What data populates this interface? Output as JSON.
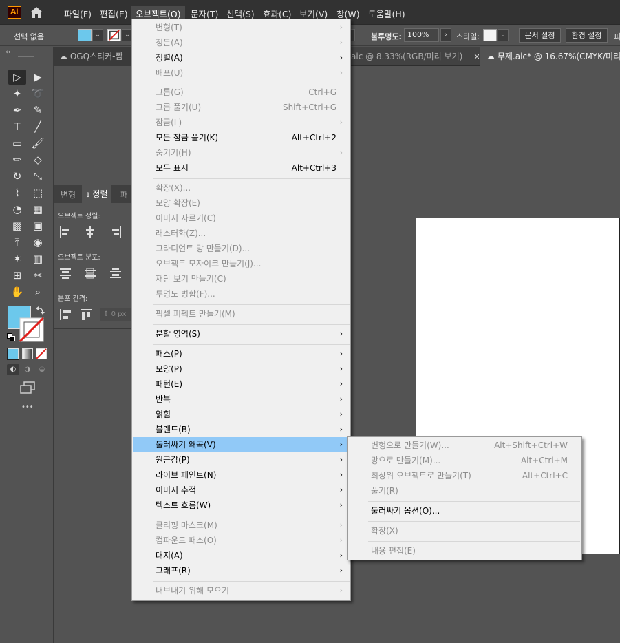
{
  "app": {
    "logo": "Ai",
    "brand_color": "#ff9a00"
  },
  "menubar": {
    "items": [
      "파일(F)",
      "편집(E)",
      "오브젝트(O)",
      "문자(T)",
      "선택(S)",
      "효과(C)",
      "보기(V)",
      "창(W)",
      "도움말(H)"
    ]
  },
  "controlbar": {
    "selection_label": "선택 없음",
    "fill_color": "#6cc8ec",
    "opacity_label": "불투명도:",
    "opacity_value": "100%",
    "style_label": "스타일:",
    "doc_setup_button": "문서 설정",
    "prefs_button": "환경 설정",
    "overflow_char": "피"
  },
  "tabs": [
    {
      "label": "OGQ스티커-짬"
    },
    {
      "label": "aic @ 8.33%(RGB/미리 보기)"
    },
    {
      "label": "무제.aic* @ 16.67%(CMYK/미리"
    }
  ],
  "tab_close": "×",
  "toolbar": {
    "grip": "‹‹",
    "tools": [
      "selection-tool",
      "direct-selection-tool",
      "magic-wand-tool",
      "lasso-tool",
      "pen-tool",
      "curvature-tool",
      "type-tool",
      "line-tool",
      "rectangle-tool",
      "paintbrush-tool",
      "pencil-tool",
      "eraser-tool",
      "rotate-tool",
      "scale-tool",
      "warp-tool",
      "free-transform-tool",
      "shape-builder-tool",
      "perspective-grid-tool",
      "mesh-tool",
      "gradient-tool",
      "eyedropper-tool",
      "blend-tool",
      "symbol-sprayer-tool",
      "column-graph-tool",
      "artboard-tool",
      "slice-tool",
      "hand-tool",
      "zoom-tool"
    ],
    "fill_color": "#6cc8ec",
    "more": "•••"
  },
  "align_panel": {
    "tabs": [
      "변형",
      "정렬",
      "패"
    ],
    "object_align_label": "오브젝트 정렬:",
    "object_distribute_label": "오브젝트 분포:",
    "distribute_spacing_label": "분포 간격:",
    "spacing_value": "0 px"
  },
  "object_menu": {
    "items": [
      {
        "label": "변형(T)",
        "shortcut": "",
        "submenu": true,
        "disabled": true
      },
      {
        "label": "정돈(A)",
        "shortcut": "",
        "submenu": true,
        "disabled": true
      },
      {
        "label": "정렬(A)",
        "shortcut": "",
        "submenu": true,
        "disabled": false
      },
      {
        "label": "배포(U)",
        "shortcut": "",
        "submenu": true,
        "disabled": true
      },
      {
        "label": "그룹(G)",
        "shortcut": "Ctrl+G",
        "submenu": false,
        "disabled": true
      },
      {
        "label": "그룹 풀기(U)",
        "shortcut": "Shift+Ctrl+G",
        "submenu": false,
        "disabled": true
      },
      {
        "label": "잠금(L)",
        "shortcut": "",
        "submenu": true,
        "disabled": true
      },
      {
        "label": "모든 잠금 풀기(K)",
        "shortcut": "Alt+Ctrl+2",
        "submenu": false,
        "disabled": false
      },
      {
        "label": "숨기기(H)",
        "shortcut": "",
        "submenu": true,
        "disabled": true
      },
      {
        "label": "모두 표시",
        "shortcut": "Alt+Ctrl+3",
        "submenu": false,
        "disabled": false
      },
      {
        "label": "확장(X)...",
        "shortcut": "",
        "submenu": false,
        "disabled": true
      },
      {
        "label": "모양 확장(E)",
        "shortcut": "",
        "submenu": false,
        "disabled": true
      },
      {
        "label": "이미지 자르기(C)",
        "shortcut": "",
        "submenu": false,
        "disabled": true
      },
      {
        "label": "래스터화(Z)...",
        "shortcut": "",
        "submenu": false,
        "disabled": true
      },
      {
        "label": "그라디언트 망 만들기(D)...",
        "shortcut": "",
        "submenu": false,
        "disabled": true
      },
      {
        "label": "오브젝트 모자이크 만들기(J)...",
        "shortcut": "",
        "submenu": false,
        "disabled": true
      },
      {
        "label": "재단 보기 만들기(C)",
        "shortcut": "",
        "submenu": false,
        "disabled": true
      },
      {
        "label": "투명도 병합(F)...",
        "shortcut": "",
        "submenu": false,
        "disabled": true
      },
      {
        "label": "픽셀 퍼펙트 만들기(M)",
        "shortcut": "",
        "submenu": false,
        "disabled": true
      },
      {
        "label": "분할 영역(S)",
        "shortcut": "",
        "submenu": true,
        "disabled": false
      },
      {
        "label": "패스(P)",
        "shortcut": "",
        "submenu": true,
        "disabled": false
      },
      {
        "label": "모양(P)",
        "shortcut": "",
        "submenu": true,
        "disabled": false
      },
      {
        "label": "패턴(E)",
        "shortcut": "",
        "submenu": true,
        "disabled": false
      },
      {
        "label": "반복",
        "shortcut": "",
        "submenu": true,
        "disabled": false
      },
      {
        "label": "얽힘",
        "shortcut": "",
        "submenu": true,
        "disabled": false
      },
      {
        "label": "블렌드(B)",
        "shortcut": "",
        "submenu": true,
        "disabled": false
      },
      {
        "label": "둘러싸기 왜곡(V)",
        "shortcut": "",
        "submenu": true,
        "disabled": false,
        "highlighted": true
      },
      {
        "label": "원근감(P)",
        "shortcut": "",
        "submenu": true,
        "disabled": false
      },
      {
        "label": "라이브 페인트(N)",
        "shortcut": "",
        "submenu": true,
        "disabled": false
      },
      {
        "label": "이미지 추적",
        "shortcut": "",
        "submenu": true,
        "disabled": false
      },
      {
        "label": "텍스트 흐름(W)",
        "shortcut": "",
        "submenu": true,
        "disabled": false
      },
      {
        "label": "클리핑 마스크(M)",
        "shortcut": "",
        "submenu": true,
        "disabled": true
      },
      {
        "label": "컴파운드 패스(O)",
        "shortcut": "",
        "submenu": true,
        "disabled": true
      },
      {
        "label": "대지(A)",
        "shortcut": "",
        "submenu": true,
        "disabled": false
      },
      {
        "label": "그래프(R)",
        "shortcut": "",
        "submenu": true,
        "disabled": false
      },
      {
        "label": "내보내기 위해 모으기",
        "shortcut": "",
        "submenu": true,
        "disabled": true
      }
    ]
  },
  "envelope_submenu": {
    "items": [
      {
        "label": "변형으로 만들기(W)...",
        "shortcut": "Alt+Shift+Ctrl+W",
        "disabled": true
      },
      {
        "label": "망으로 만들기(M)...",
        "shortcut": "Alt+Ctrl+M",
        "disabled": true
      },
      {
        "label": "최상위 오브젝트로 만들기(T)",
        "shortcut": "Alt+Ctrl+C",
        "disabled": true
      },
      {
        "label": "풀기(R)",
        "shortcut": "",
        "disabled": true
      },
      {
        "label": "둘러싸기 옵션(O)...",
        "shortcut": "",
        "disabled": false
      },
      {
        "label": "확장(X)",
        "shortcut": "",
        "disabled": true
      },
      {
        "label": "내용 편집(E)",
        "shortcut": "",
        "disabled": true
      }
    ]
  },
  "arrow_glyph": "›"
}
